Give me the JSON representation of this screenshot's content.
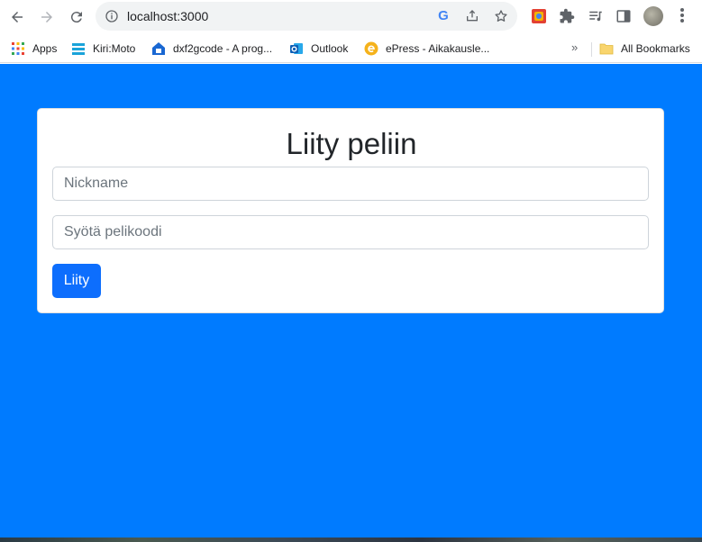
{
  "browser": {
    "url": "localhost:3000",
    "bookmarks": [
      {
        "label": "Apps",
        "icon": "apps-grid-icon"
      },
      {
        "label": "Kiri:Moto",
        "icon": "kirimoto-icon"
      },
      {
        "label": "dxf2gcode - A prog...",
        "icon": "dxf2gcode-icon"
      },
      {
        "label": "Outlook",
        "icon": "outlook-icon"
      },
      {
        "label": "ePress - Aikakausle...",
        "icon": "epress-icon"
      }
    ],
    "more_bookmarks": "»",
    "all_bookmarks": "All Bookmarks"
  },
  "page": {
    "background_color": "#007bff",
    "title": "Liity peliin",
    "nickname_placeholder": "Nickname",
    "code_placeholder": "Syötä pelikoodi",
    "join_button": "Liity",
    "button_color": "#0d6efd"
  }
}
